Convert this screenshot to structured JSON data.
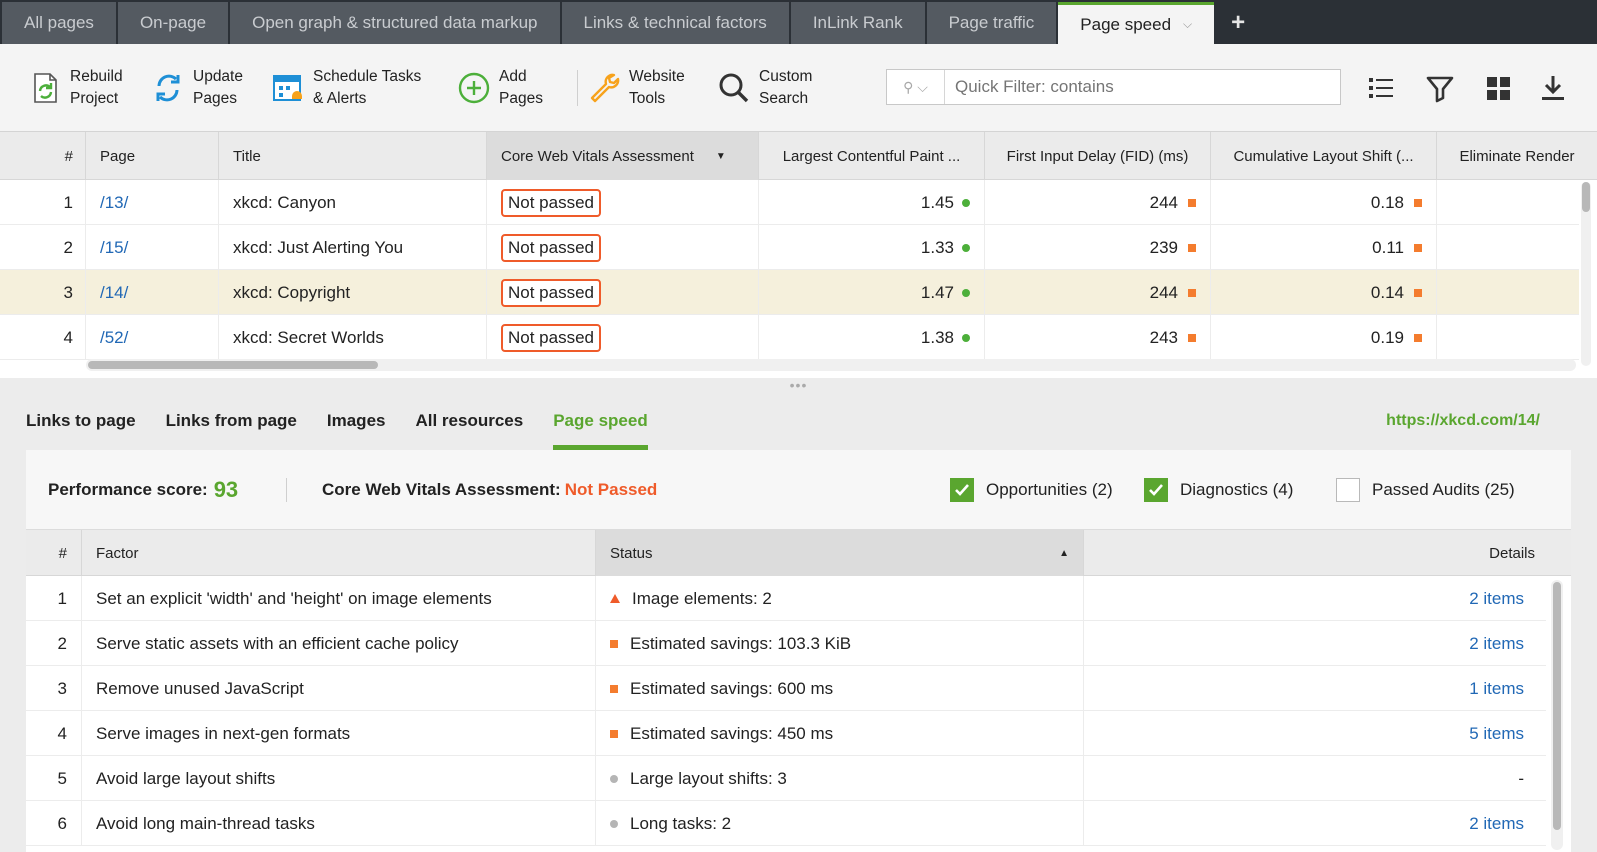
{
  "tabs": [
    {
      "label": "All pages"
    },
    {
      "label": "On-page"
    },
    {
      "label": "Open graph & structured data markup"
    },
    {
      "label": "Links & technical factors"
    },
    {
      "label": "InLink Rank"
    },
    {
      "label": "Page traffic"
    },
    {
      "label": "Page speed",
      "active": true
    }
  ],
  "toolbar": {
    "rebuild": "Rebuild Project",
    "update": "Update Pages",
    "schedule": "Schedule Tasks & Alerts",
    "add": "Add Pages",
    "website_tools": "Website Tools",
    "custom_search": "Custom Search",
    "quick_filter_placeholder": "Quick Filter: contains"
  },
  "top_grid": {
    "columns": [
      "#",
      "Page",
      "Title",
      "Core Web Vitals Assessment",
      "Largest Contentful Paint ...",
      "First Input Delay (FID) (ms)",
      "Cumulative Layout Shift (...",
      "Eliminate Render"
    ],
    "rows": [
      {
        "num": "1",
        "page": "/13/",
        "title": "xkcd: Canyon",
        "cwv": "Not passed",
        "lcp": "1.45",
        "fid": "244",
        "cls": "0.18"
      },
      {
        "num": "2",
        "page": "/15/",
        "title": "xkcd: Just Alerting You",
        "cwv": "Not passed",
        "lcp": "1.33",
        "fid": "239",
        "cls": "0.11"
      },
      {
        "num": "3",
        "page": "/14/",
        "title": "xkcd: Copyright",
        "cwv": "Not passed",
        "lcp": "1.47",
        "fid": "244",
        "cls": "0.14"
      },
      {
        "num": "4",
        "page": "/52/",
        "title": "xkcd: Secret Worlds",
        "cwv": "Not passed",
        "lcp": "1.38",
        "fid": "243",
        "cls": "0.19"
      }
    ]
  },
  "subtabs": [
    "Links to page",
    "Links from page",
    "Images",
    "All resources",
    "Page speed"
  ],
  "url": "https://xkcd.com/14/",
  "summary": {
    "perf_label": "Performance score:",
    "perf_score": "93",
    "cwv_label": "Core Web Vitals Assessment:",
    "cwv_value": "Not Passed",
    "opportunities": "Opportunities (2)",
    "diagnostics": "Diagnostics (4)",
    "passed": "Passed Audits (25)"
  },
  "factors": {
    "columns": [
      "#",
      "Factor",
      "Status",
      "Details"
    ],
    "rows": [
      {
        "num": "1",
        "factor": "Set an explicit 'width' and 'height' on image elements",
        "status": "Image elements: 2",
        "kind": "tri",
        "details": "2 items"
      },
      {
        "num": "2",
        "factor": "Serve static assets with an efficient cache policy",
        "status": "Estimated savings: 103.3 KiB",
        "kind": "sq",
        "details": "2 items"
      },
      {
        "num": "3",
        "factor": "Remove unused JavaScript",
        "status": "Estimated savings: 600 ms",
        "kind": "sq",
        "details": "1 items"
      },
      {
        "num": "4",
        "factor": "Serve images in next-gen formats",
        "status": "Estimated savings: 450 ms",
        "kind": "sq",
        "details": "5 items"
      },
      {
        "num": "5",
        "factor": "Avoid large layout shifts",
        "status": "Large layout shifts: 3",
        "kind": "dot",
        "details": "-"
      },
      {
        "num": "6",
        "factor": "Avoid long main-thread tasks",
        "status": "Long tasks: 2",
        "kind": "dot",
        "details": "2 items"
      }
    ]
  },
  "colors": {
    "accent": "#5aa62f",
    "alert": "#ef5b2a",
    "link": "#2168b5"
  }
}
